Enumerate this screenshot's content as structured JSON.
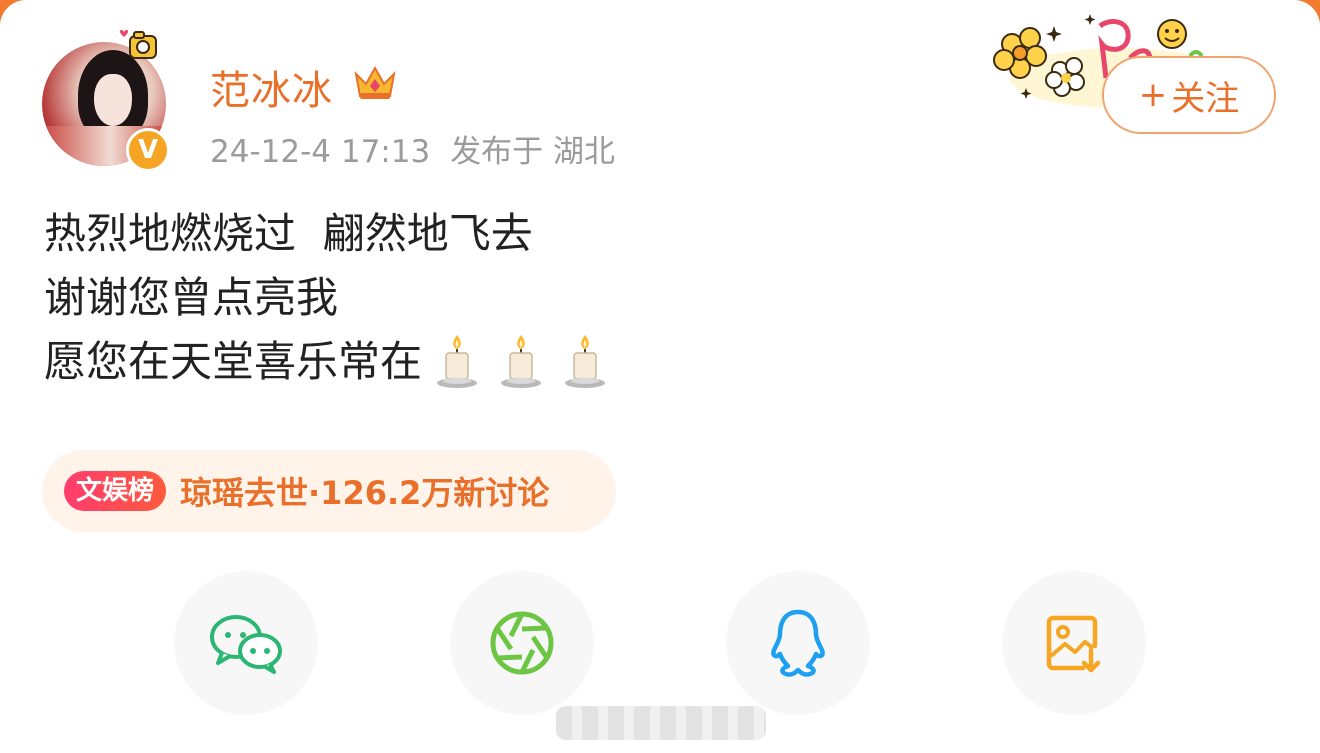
{
  "user": {
    "name": "范冰冰",
    "verified_mark": "V",
    "timestamp": "24-12-4 17:13",
    "location": "发布于 湖北"
  },
  "follow_button": {
    "plus": "+",
    "label": "关注"
  },
  "post": {
    "lines": [
      "热烈地燃烧过  翩然地飞去",
      "谢谢您曾点亮我",
      "愿您在天堂喜乐常在"
    ],
    "trailing_emoji": [
      "candle-emoji",
      "candle-emoji",
      "candle-emoji"
    ]
  },
  "hot_topic": {
    "badge": "文娱榜",
    "text": "琼瑶去世·126.2万新讨论"
  },
  "share_actions": [
    {
      "icon": "wechat-icon",
      "color": "#2bb673"
    },
    {
      "icon": "moments-icon",
      "color": "#6cc644"
    },
    {
      "icon": "qq-icon",
      "color": "#1ea0f0"
    },
    {
      "icon": "save-image-icon",
      "color": "#f5a623"
    }
  ],
  "colors": {
    "accent": "#e8702a",
    "background_frame": "#f27a2e",
    "hot_badge": "#ff3d6e"
  }
}
